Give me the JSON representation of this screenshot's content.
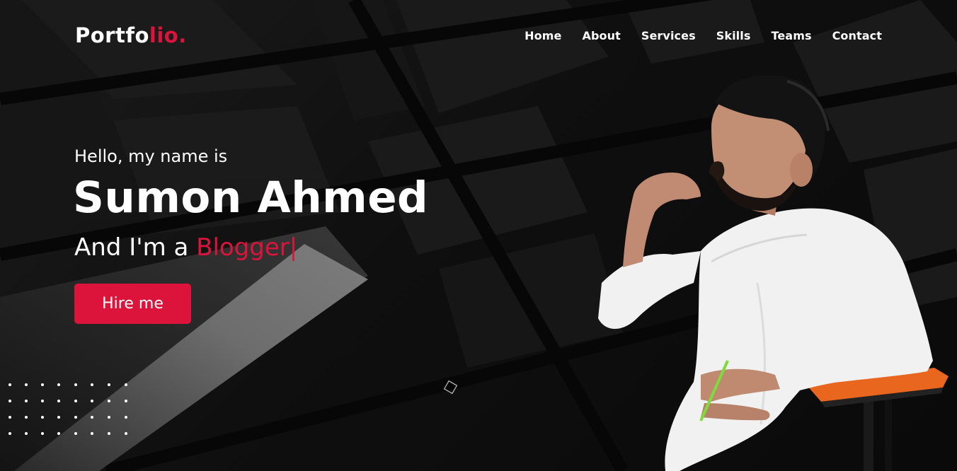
{
  "logo": {
    "text": "Portfo",
    "accent": "lio."
  },
  "nav": {
    "items": [
      "Home",
      "About",
      "Services",
      "Skills",
      "Teams",
      "Contact"
    ]
  },
  "hero": {
    "intro": "Hello, my name is",
    "name": "Sumon Ahmed",
    "role_prefix": "And I'm a ",
    "role_typed": "Blogger",
    "cursor": "|",
    "button": "Hire me"
  },
  "colors": {
    "accent": "#dc143c",
    "background": "#0c0c0c",
    "text": "#ffffff"
  },
  "icons": {
    "pattern": "dot-grid",
    "shape": "outlined-diamond"
  }
}
